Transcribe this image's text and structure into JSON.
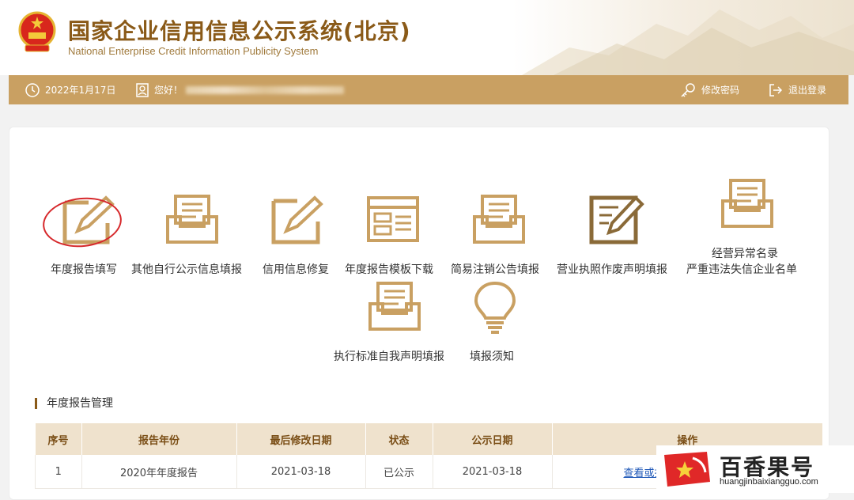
{
  "header": {
    "title": "国家企业信用信息公示系统(北京)",
    "subtitle": "National Enterprise Credit Information Publicity System",
    "accent_color": "#8a5a18"
  },
  "topbar": {
    "date": "2022年1月17日",
    "greeting": "您好！",
    "change_password": "修改密码",
    "logout": "退出登录",
    "bar_color": "#c9a062"
  },
  "tiles": [
    {
      "label": "年度报告填写",
      "icon": "pencil-note-icon"
    },
    {
      "label": "其他自行公示信息填报",
      "icon": "document-tray-icon"
    },
    {
      "label": "信用信息修复",
      "icon": "pencil-note-icon"
    },
    {
      "label": "年度报告模板下载",
      "icon": "template-window-icon"
    },
    {
      "label": "简易注销公告填报",
      "icon": "document-tray-icon"
    },
    {
      "label": "营业执照作废声明填报",
      "icon": "certificate-edit-icon"
    },
    {
      "label": "经营异常名录",
      "label2": "严重违法失信企业名单",
      "icon": "document-tray-icon"
    },
    {
      "label": "执行标准自我声明填报",
      "icon": "document-tray-icon"
    },
    {
      "label": "填报须知",
      "icon": "lightbulb-icon"
    }
  ],
  "annual_report": {
    "section_title": "年度报告管理",
    "columns": [
      "序号",
      "报告年份",
      "最后修改日期",
      "状态",
      "公示日期",
      "操作"
    ],
    "rows": [
      [
        "1",
        "2020年年度报告",
        "2021-03-18",
        "已公示",
        "2021-03-18",
        "查看或打印"
      ]
    ]
  },
  "watermark": {
    "name": "百香果号",
    "url": "huangjinbaixiangguo.com"
  }
}
